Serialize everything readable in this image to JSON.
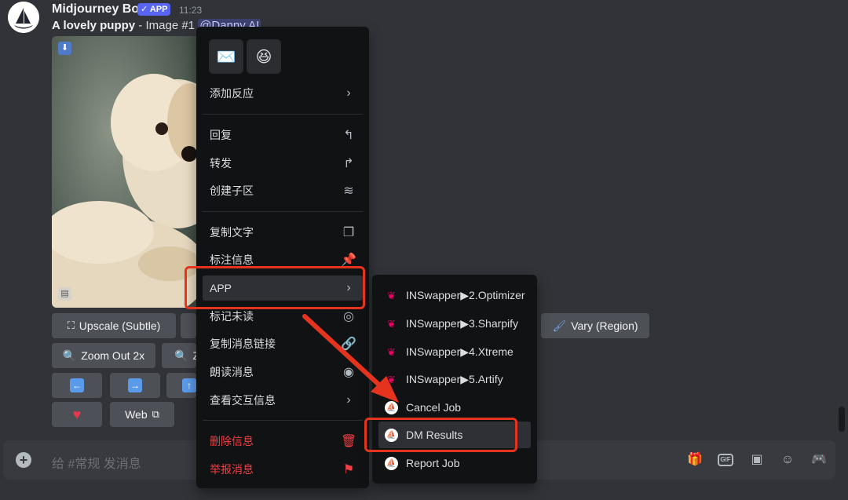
{
  "message": {
    "author": "Midjourney Bot",
    "badge": "✓ APP",
    "time": "11:23",
    "title_bold": "A lovely puppy",
    "title_rest": " - Image #1 ",
    "mention": "@Danny AI"
  },
  "buttons": {
    "upscale_subtle": "Upscale (Subtle)",
    "vary_region": "Vary (Region)",
    "zoom_out_2x": "Zoom Out 2x",
    "zoom_partial": "Z",
    "web": "Web"
  },
  "composer": {
    "placeholder": "给 #常规 发消息",
    "gif": "GIF"
  },
  "context_menu": {
    "reaction_emojis": [
      "✉️",
      "😆"
    ],
    "add_reaction": "添加反应",
    "reply": "回复",
    "forward": "转发",
    "create_thread": "创建子区",
    "copy_text": "复制文字",
    "pin_message": "标注信息",
    "apps": "APP",
    "mark_unread": "标记未读",
    "copy_link": "复制消息链接",
    "speak": "朗读消息",
    "view_interaction": "查看交互信息",
    "delete": "删除信息",
    "report": "举报消息"
  },
  "submenu": {
    "items": [
      "INSwapper▶2.Optimizer",
      "INSwapper▶3.Sharpify",
      "INSwapper▶4.Xtreme",
      "INSwapper▶5.Artify",
      "Cancel Job",
      "DM Results",
      "Report Job"
    ]
  },
  "colors": {
    "background": "#313338",
    "menu": "#111214",
    "accent": "#5865f2",
    "danger": "#f23f43",
    "annotation": "#e5341d"
  }
}
